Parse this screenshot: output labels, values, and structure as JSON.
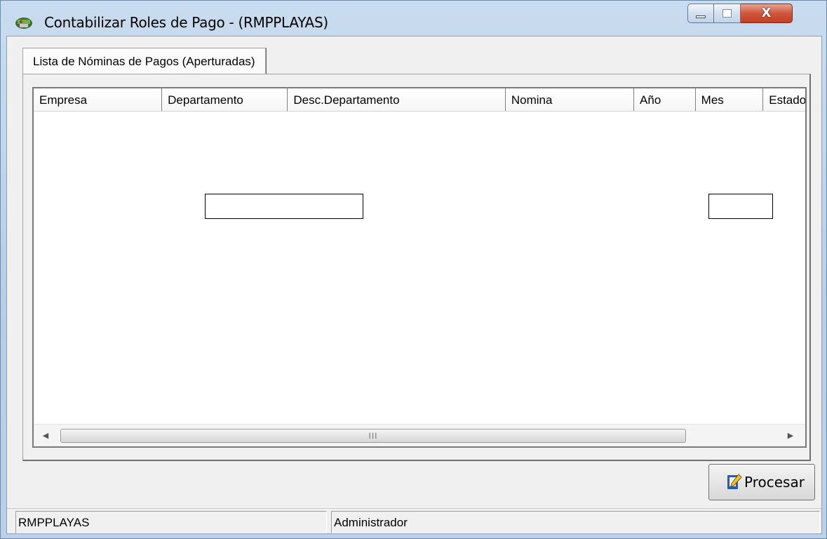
{
  "window": {
    "title": "Contabilizar Roles de Pago - (RMPPLAYAS)",
    "close_label": "X",
    "accent_close": "#c94a2e"
  },
  "tabs": [
    {
      "label": "Lista de Nóminas de Pagos (Aperturadas)",
      "selected": true
    }
  ],
  "list": {
    "columns": [
      "Empresa",
      "Departamento",
      "Desc.Departamento",
      "Nomina",
      "Año",
      "Mes",
      "Estado"
    ],
    "rows": [],
    "scroll_grip": "III"
  },
  "actions": {
    "process_label": "Procesar"
  },
  "status": {
    "database": "RMPPLAYAS",
    "user": "Administrador"
  }
}
